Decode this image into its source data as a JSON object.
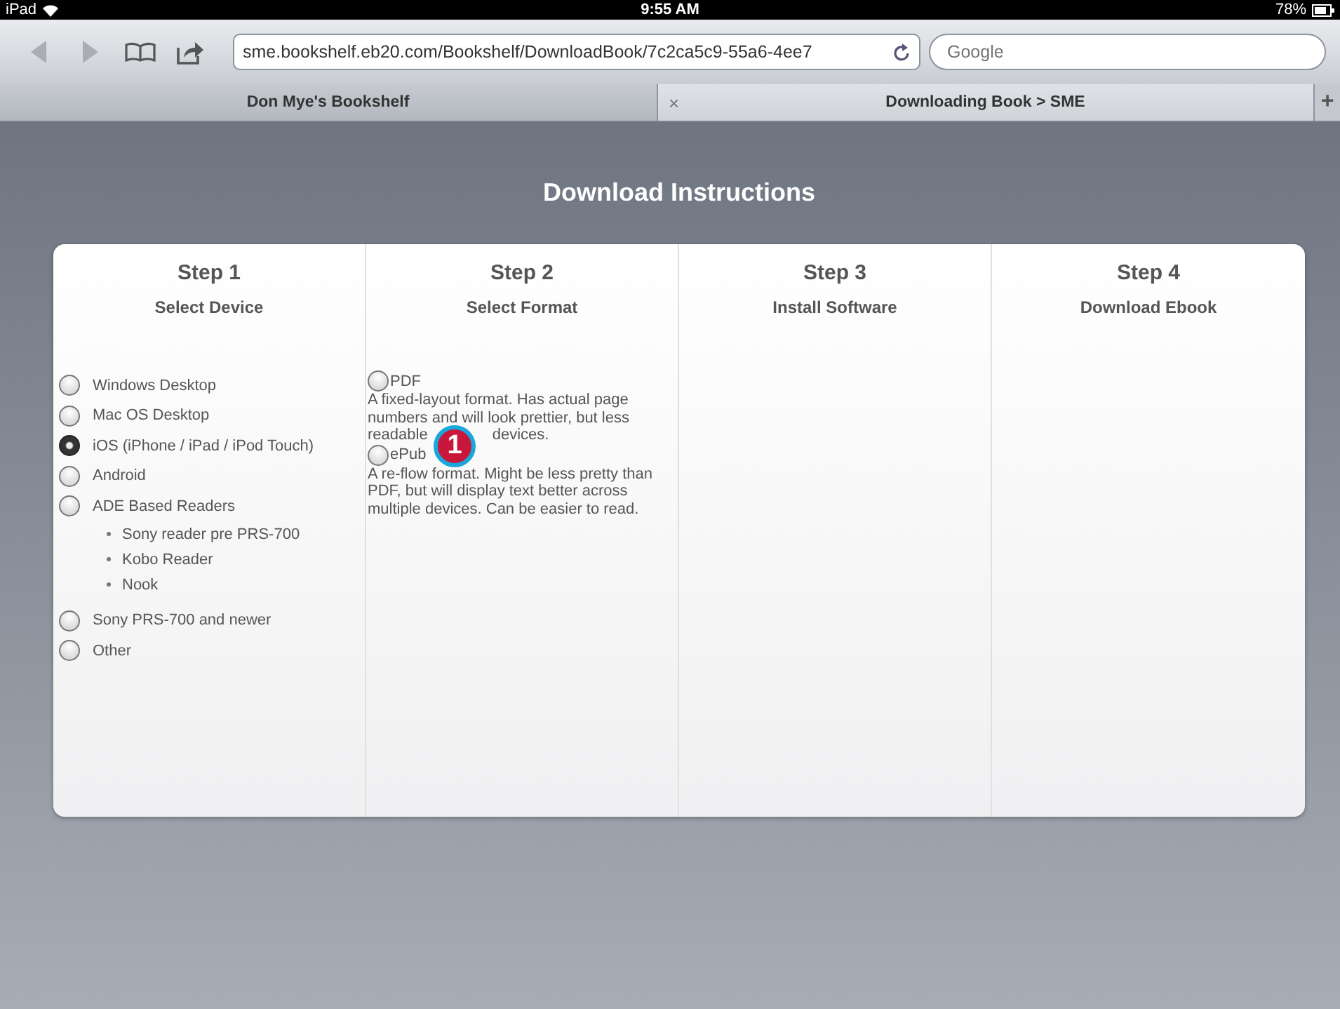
{
  "status_bar": {
    "device": "iPad",
    "time": "9:55 AM",
    "battery": "78%"
  },
  "toolbar": {
    "url": "sme.bookshelf.eb20.com/Bookshelf/DownloadBook/7c2ca5c9-55a6-4ee7",
    "search": {
      "placeholder": "Google"
    }
  },
  "tabs": [
    {
      "label": "Don Mye's Bookshelf",
      "selected": false
    },
    {
      "label": "Downloading Book > SME",
      "selected": true,
      "close": "×"
    }
  ],
  "new_tab": "+",
  "page": {
    "title": "Download Instructions",
    "steps": [
      {
        "step": "Step 1",
        "subtitle": "Select Device"
      },
      {
        "step": "Step 2",
        "subtitle": "Select Format"
      },
      {
        "step": "Step 3",
        "subtitle": "Install Software"
      },
      {
        "step": "Step 4",
        "subtitle": "Download Ebook"
      }
    ],
    "devices": [
      {
        "label": "Windows Desktop",
        "selected": false
      },
      {
        "label": "Mac OS Desktop",
        "selected": false
      },
      {
        "label": "iOS (iPhone / iPad / iPod Touch)",
        "selected": true
      },
      {
        "label": "Android",
        "selected": false
      },
      {
        "label": "ADE Based Readers",
        "selected": false,
        "children": [
          "Sony reader pre PRS-700",
          "Kobo Reader",
          "Nook"
        ]
      },
      {
        "label": "Sony PRS-700 and newer",
        "selected": false
      },
      {
        "label": "Other",
        "selected": false
      }
    ],
    "formats": [
      {
        "label": "PDF",
        "selected": false,
        "lines": [
          "A fixed-layout format. Has actual page",
          "numbers and will look prettier, but less"
        ],
        "last_parts": [
          "readable",
          "devices."
        ]
      },
      {
        "label": "ePub",
        "selected": false,
        "lines": [
          "A re-flow format. Might be less pretty than",
          "PDF, but will display text better across",
          "multiple devices. Can be easier to read."
        ]
      }
    ]
  },
  "callout": "1"
}
